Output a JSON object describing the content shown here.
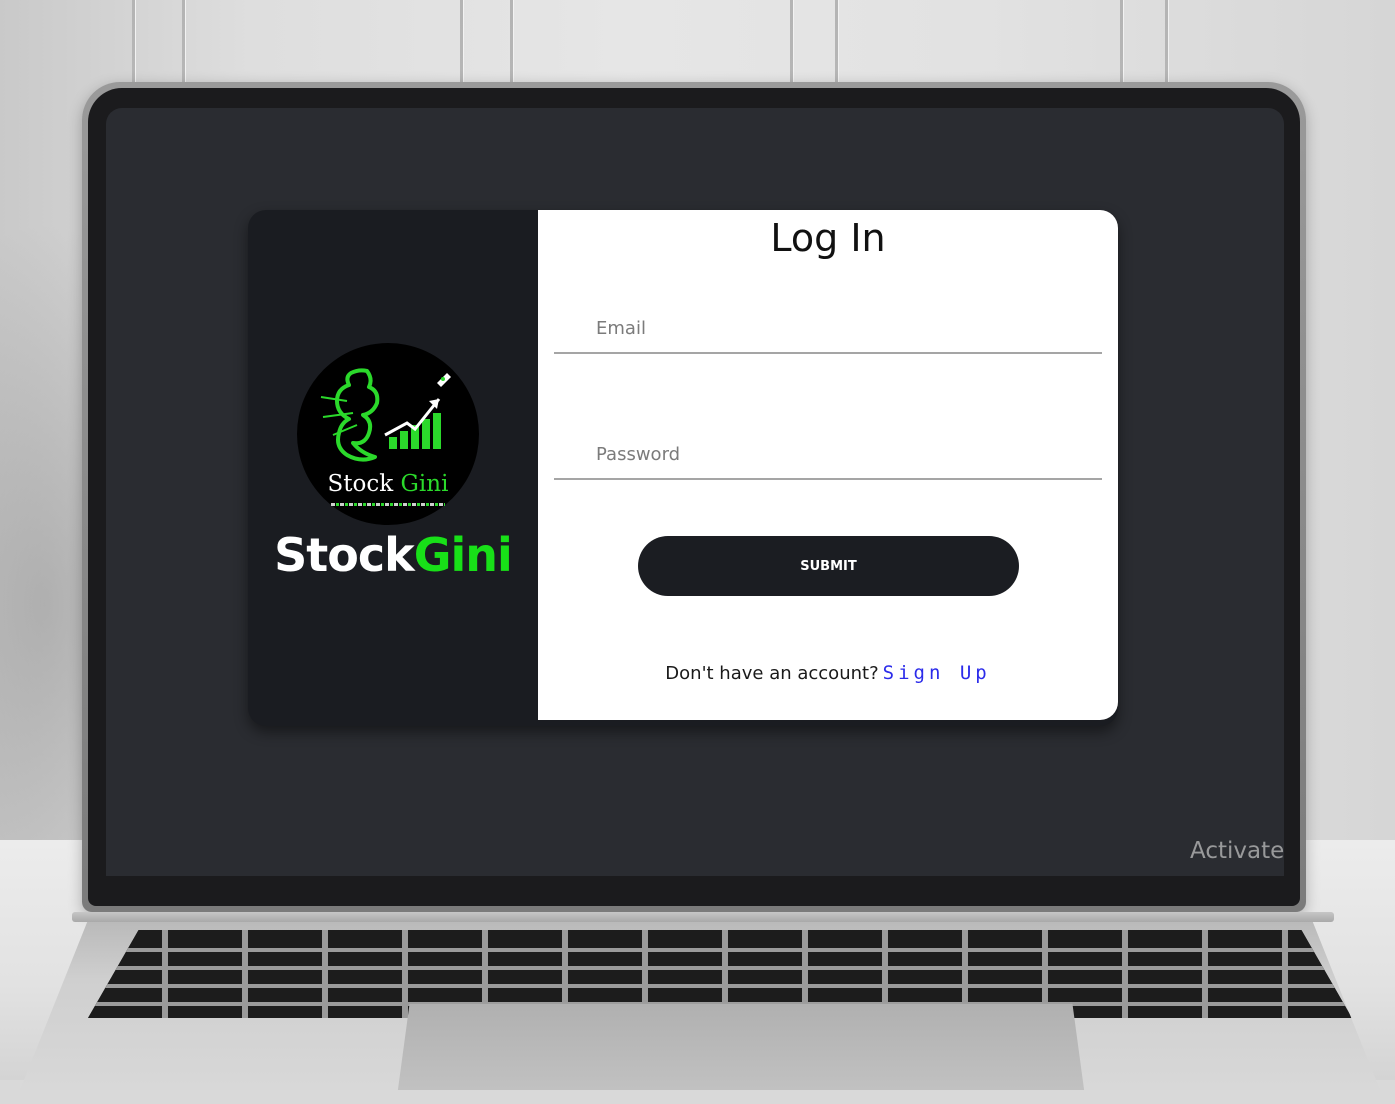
{
  "brand": {
    "logo_text_white": "Stock",
    "logo_text_green": "Gini",
    "name_white": "Stock",
    "name_green": "Gini",
    "green_color": "#18e018"
  },
  "login": {
    "title": "Log In",
    "email_placeholder": "Email",
    "password_placeholder": "Password",
    "submit_label": "SUBMIT",
    "signup_prompt": "Don't have an account?",
    "signup_link": "Sign Up"
  },
  "os": {
    "activate_watermark": "Activate"
  },
  "colors": {
    "screen_bg": "#2a2c31",
    "card_dark": "#1a1c21",
    "link_blue": "#2b2bea"
  }
}
